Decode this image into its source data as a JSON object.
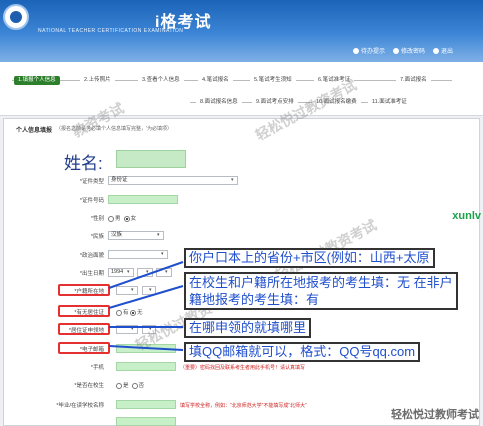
{
  "header": {
    "title": "i格考试",
    "subtitle": "NATIONAL TEACHER CERTIFICATION EXAMINATION",
    "links": [
      "待办提示",
      "修改密码",
      "退出"
    ]
  },
  "steps": [
    "1.填报个人信息",
    "2.上传照片",
    "3.查看个人信息",
    "4.笔试报名",
    "5.笔试考生须知",
    "6.笔试准考证",
    "7.面试报名",
    "8.面试报名信息",
    "9.面试考点安排",
    "10.面试报名缴费",
    "11.面试准考证"
  ],
  "panel": {
    "title": "个人信息填报",
    "note": "（报名之前请务必填个人信息填写完整，'为必填项）"
  },
  "form": {
    "name_label": "姓名:",
    "cert_type_label": "*证件类型",
    "cert_type_value": "身份证",
    "cert_number_label": "*证件号码",
    "gender_label": "*性别",
    "gender_options": [
      "男",
      "女"
    ],
    "ethnicity_label": "*民族",
    "ethnicity_value": "汉族",
    "politics_label": "*政治面貌",
    "birth_label": "*出生日期",
    "birth_year": "1994",
    "hukou_label": "*户籍所在地",
    "has_residence_label": "*有无居住证",
    "has_residence_options": [
      "有",
      "无"
    ],
    "residence_place_label": "*居住证申领地",
    "email_label": "*电子邮箱",
    "phone_label": "*手机",
    "phone_note": "（重要）密码找回及联系考生者用此手机号！请认真填写",
    "enrolled_label": "*是否在校生",
    "enrolled_options": [
      "是",
      "否"
    ],
    "school_label": "*毕业/在读学校名称",
    "school_note": "填写学校全称，例如：“北京师范大学”不能填写成“北师大”"
  },
  "callouts": {
    "hukou": "你户口本上的省份+市区(例如：山西+太原",
    "residence_line1": "在校生和户籍所在地报考的考生填：无 在非户",
    "residence_line2": "籍地报考的考生填：有",
    "residence_place": "在哪申领的就填哪里",
    "email": "填QQ邮箱就可以，格式：QQ号qq.com"
  },
  "watermarks": [
    "教资考试",
    "轻松悦过教资考试"
  ],
  "side_tag": "xunlv",
  "brand": "轻松悦过教师考试",
  "colors": {
    "header": "#2f78cf",
    "active_step": "#2d7f2c",
    "callout_text": "#1f4fcc",
    "highlight_box": "#e53030",
    "green_field": "#c8f0c8"
  }
}
